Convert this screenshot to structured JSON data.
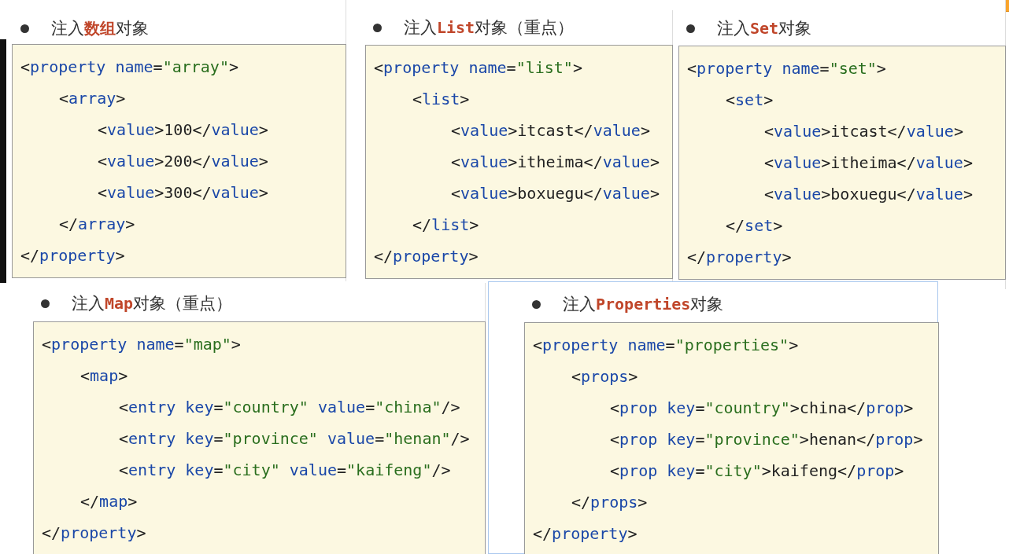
{
  "snippets": [
    {
      "heading": "注入**数组**对象",
      "lines": [
        {
          "text": "<property name=\"array\">",
          "children": [
            {
              "text": "<array>",
              "children": [
                {
                  "text": "<value>100</value>"
                },
                {
                  "text": "<value>200</value>"
                },
                {
                  "text": "<value>300</value>"
                }
              ]
            },
            {
              "text": "</array>"
            }
          ]
        },
        {
          "text": "</property>"
        }
      ]
    },
    {
      "heading": "注入**List**对象（重点）",
      "lines": [
        {
          "text": "<property name=\"list\">",
          "children": [
            {
              "text": "<list>",
              "children": [
                {
                  "text": "<value>itcast</value>"
                },
                {
                  "text": "<value>itheima</value>"
                },
                {
                  "text": "<value>boxuegu</value>"
                }
              ]
            },
            {
              "text": "</list>"
            }
          ]
        },
        {
          "text": "</property>"
        }
      ]
    },
    {
      "heading": "注入**Set**对象",
      "lines": [
        {
          "text": "<property name=\"set\">",
          "children": [
            {
              "text": "<set>",
              "children": [
                {
                  "text": "<value>itcast</value>"
                },
                {
                  "text": "<value>itheima</value>"
                },
                {
                  "text": "<value>boxuegu</value>"
                }
              ]
            },
            {
              "text": "</set>"
            }
          ]
        },
        {
          "text": "</property>"
        }
      ]
    },
    {
      "heading": "注入**Map**对象（重点）",
      "lines": [
        {
          "text": "<property name=\"map\">",
          "children": [
            {
              "text": "<map>",
              "children": [
                {
                  "text": "<entry key=\"country\" value=\"china\"/>"
                },
                {
                  "text": "<entry key=\"province\" value=\"henan\"/>"
                },
                {
                  "text": "<entry key=\"city\" value=\"kaifeng\"/>"
                }
              ]
            },
            {
              "text": "</map>"
            }
          ]
        },
        {
          "text": "</property>"
        }
      ]
    },
    {
      "heading": "注入**Properties**对象",
      "lines": [
        {
          "text": "<property name=\"properties\">",
          "children": [
            {
              "text": "<props>",
              "children": [
                {
                  "text": "<prop key=\"country\">china</prop>"
                },
                {
                  "text": "<prop key=\"province\">henan</prop>"
                },
                {
                  "text": "<prop key=\"city\">kaifeng</prop>"
                }
              ]
            },
            {
              "text": "</props>"
            }
          ]
        },
        {
          "text": "</property>"
        }
      ]
    }
  ]
}
